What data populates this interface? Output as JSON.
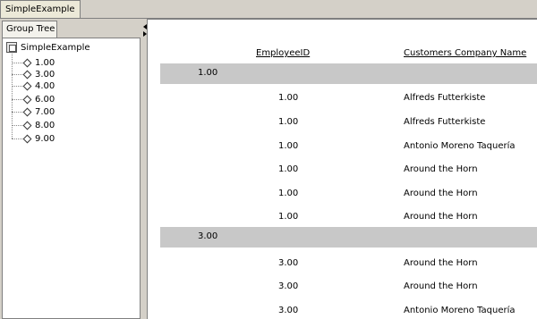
{
  "document_tab": {
    "title": "SimpleExample"
  },
  "group_tree": {
    "tab_label": "Group Tree",
    "root_label": "SimpleExample",
    "items": [
      "1.00",
      "3.00",
      "4.00",
      "6.00",
      "7.00",
      "8.00",
      "9.00"
    ]
  },
  "report": {
    "headers": {
      "employee_id": "EmployeeID",
      "customer_company": "Customers Company Name"
    },
    "groups": [
      {
        "value": "1.00",
        "rows": [
          {
            "employee_id": "1.00",
            "company": "Alfreds Futterkiste"
          },
          {
            "employee_id": "1.00",
            "company": "Alfreds Futterkiste"
          },
          {
            "employee_id": "1.00",
            "company": "Antonio Moreno Taquería"
          },
          {
            "employee_id": "1.00",
            "company": "Around the Horn"
          },
          {
            "employee_id": "1.00",
            "company": "Around the Horn"
          },
          {
            "employee_id": "1.00",
            "company": "Around the Horn"
          }
        ]
      },
      {
        "value": "3.00",
        "rows": [
          {
            "employee_id": "3.00",
            "company": "Around the Horn"
          },
          {
            "employee_id": "3.00",
            "company": "Around the Horn"
          },
          {
            "employee_id": "3.00",
            "company": "Antonio Moreno Taquería"
          }
        ]
      }
    ]
  }
}
